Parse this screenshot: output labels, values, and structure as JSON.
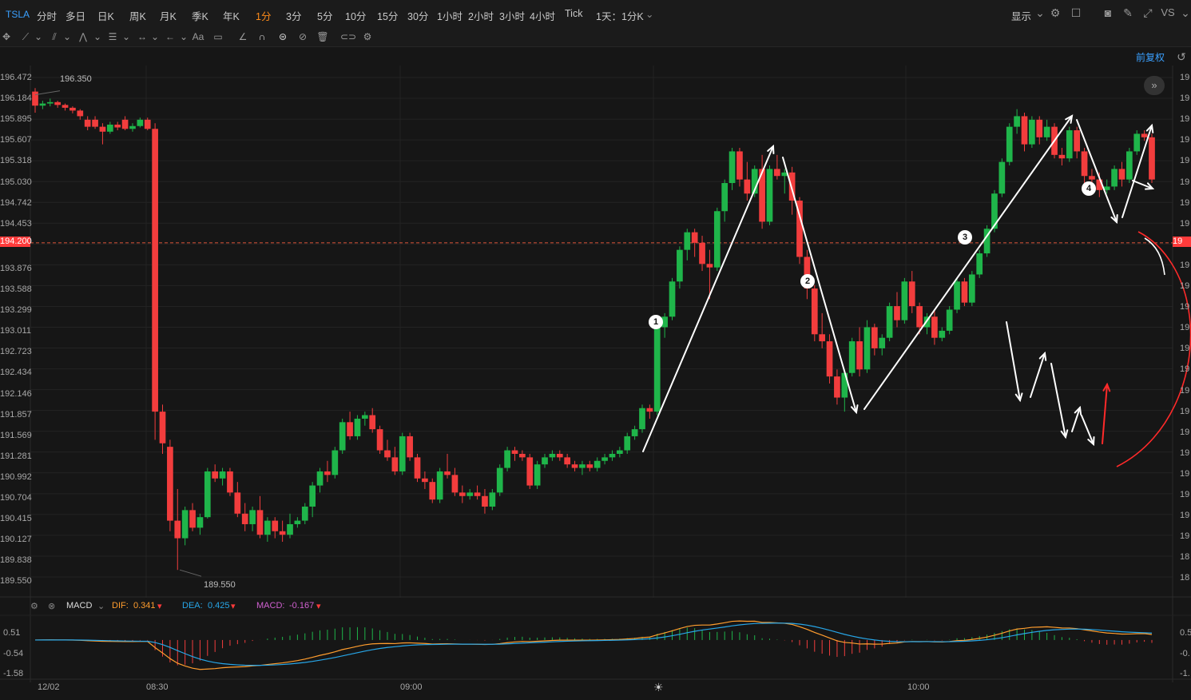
{
  "symbol": "TSLA",
  "timeframes": [
    "分时",
    "多日",
    "日K",
    "周K",
    "月K",
    "季K",
    "年K",
    "1分",
    "3分",
    "5分",
    "10分",
    "15分",
    "30分",
    "1小时",
    "2小时",
    "3小时",
    "4小时",
    "Tick"
  ],
  "active_timeframe": "1分",
  "period_select": "1天：1分K",
  "display_label": "显示",
  "adjust_label": "前复权",
  "y_axis_left": [
    "196.472",
    "196.184",
    "195.895",
    "195.607",
    "195.318",
    "195.030",
    "194.742",
    "194.453",
    "194.200",
    "193.876",
    "193.588",
    "193.299",
    "193.011",
    "192.723",
    "192.434",
    "192.146",
    "191.857",
    "191.569",
    "191.281",
    "190.992",
    "190.704",
    "190.415",
    "190.127",
    "189.838",
    "189.550"
  ],
  "current_price_label": "194.200",
  "high_label": "196.350",
  "low_label": "189.550",
  "right_axis_labels": [
    "19",
    "19",
    "19",
    "19",
    "19",
    "19",
    "19",
    "19",
    "19",
    "19",
    "19",
    "19",
    "19",
    "19",
    "19",
    "19",
    "19",
    "19",
    "19",
    "19",
    "19",
    "19",
    "18",
    "18"
  ],
  "right_price_tag": "19",
  "macd": {
    "name": "MACD",
    "dif_label": "DIF:",
    "dif_value": "0.341",
    "dea_label": "DEA:",
    "dea_value": "0.425",
    "macd_label": "MACD:",
    "macd_value": "-0.167",
    "y_left": [
      "0.51",
      "-0.54",
      "-1.58"
    ],
    "y_right": [
      "0.5",
      "-0.",
      "-1."
    ]
  },
  "x_axis": [
    "12/02",
    "08:30",
    "09:00",
    "10:00"
  ],
  "annotations": [
    "1",
    "2",
    "3",
    "4"
  ],
  "colors": {
    "up": "#1fb54a",
    "down": "#f23d3d",
    "accent": "#ff8c1a",
    "link": "#3aa0ff",
    "dif": "#ff9d2e",
    "dea": "#27a6e8",
    "macd": "#d060d0"
  },
  "chart_data": {
    "type": "candlestick",
    "interval": "1min",
    "ylim": [
      189.45,
      196.55
    ],
    "candles_ohlc": [
      [
        196.35,
        196.4,
        196.05,
        196.15
      ],
      [
        196.15,
        196.22,
        196.1,
        196.18
      ],
      [
        196.18,
        196.25,
        196.14,
        196.2
      ],
      [
        196.2,
        196.22,
        196.12,
        196.16
      ],
      [
        196.16,
        196.18,
        196.08,
        196.12
      ],
      [
        196.12,
        196.14,
        196.04,
        196.08
      ],
      [
        196.08,
        196.1,
        195.95,
        196.0
      ],
      [
        195.95,
        196.0,
        195.8,
        195.85
      ],
      [
        195.95,
        196.0,
        195.82,
        195.85
      ],
      [
        195.85,
        195.9,
        195.6,
        195.78
      ],
      [
        195.78,
        195.92,
        195.75,
        195.88
      ],
      [
        195.88,
        195.92,
        195.8,
        195.84
      ],
      [
        195.95,
        196.0,
        195.8,
        195.82
      ],
      [
        195.82,
        195.9,
        195.78,
        195.86
      ],
      [
        195.86,
        195.98,
        195.84,
        195.95
      ],
      [
        195.95,
        195.98,
        195.8,
        195.82
      ],
      [
        195.82,
        195.9,
        191.4,
        191.8
      ],
      [
        191.8,
        191.9,
        191.2,
        191.35
      ],
      [
        191.3,
        191.4,
        190.1,
        190.25
      ],
      [
        190.25,
        190.7,
        189.55,
        190.0
      ],
      [
        190.0,
        190.45,
        189.9,
        190.4
      ],
      [
        190.4,
        190.5,
        190.1,
        190.15
      ],
      [
        190.15,
        190.35,
        190.05,
        190.3
      ],
      [
        190.3,
        191.0,
        190.28,
        190.95
      ],
      [
        190.95,
        191.05,
        190.8,
        190.85
      ],
      [
        190.85,
        191.0,
        190.75,
        190.95
      ],
      [
        190.95,
        191.0,
        190.6,
        190.65
      ],
      [
        190.65,
        190.8,
        190.3,
        190.35
      ],
      [
        190.35,
        190.5,
        190.1,
        190.2
      ],
      [
        190.2,
        190.45,
        190.1,
        190.4
      ],
      [
        190.4,
        190.6,
        190.0,
        190.05
      ],
      [
        190.05,
        190.3,
        189.95,
        190.25
      ],
      [
        190.25,
        190.3,
        190.0,
        190.1
      ],
      [
        190.1,
        190.25,
        189.95,
        190.05
      ],
      [
        190.05,
        190.35,
        190.0,
        190.2
      ],
      [
        190.2,
        190.3,
        190.15,
        190.25
      ],
      [
        190.25,
        190.5,
        190.2,
        190.45
      ],
      [
        190.45,
        190.8,
        190.3,
        190.75
      ],
      [
        190.75,
        191.0,
        190.65,
        190.95
      ],
      [
        190.95,
        191.1,
        190.8,
        190.9
      ],
      [
        190.9,
        191.3,
        190.85,
        191.25
      ],
      [
        191.25,
        191.7,
        191.2,
        191.65
      ],
      [
        191.65,
        191.8,
        191.4,
        191.45
      ],
      [
        191.45,
        191.75,
        191.4,
        191.7
      ],
      [
        191.7,
        191.8,
        191.6,
        191.75
      ],
      [
        191.75,
        191.85,
        191.5,
        191.55
      ],
      [
        191.55,
        191.6,
        191.2,
        191.25
      ],
      [
        191.25,
        191.4,
        191.1,
        191.15
      ],
      [
        191.15,
        191.3,
        190.9,
        190.95
      ],
      [
        190.95,
        191.5,
        190.9,
        191.45
      ],
      [
        191.45,
        191.5,
        191.1,
        191.15
      ],
      [
        191.15,
        191.2,
        190.8,
        190.85
      ],
      [
        190.85,
        190.95,
        190.7,
        190.8
      ],
      [
        190.8,
        190.85,
        190.5,
        190.55
      ],
      [
        190.55,
        191.0,
        190.5,
        190.95
      ],
      [
        190.95,
        191.2,
        190.85,
        190.9
      ],
      [
        190.9,
        191.0,
        190.6,
        190.65
      ],
      [
        190.65,
        190.75,
        190.5,
        190.6
      ],
      [
        190.6,
        190.7,
        190.55,
        190.65
      ],
      [
        190.65,
        190.75,
        190.55,
        190.6
      ],
      [
        190.6,
        190.7,
        190.35,
        190.45
      ],
      [
        190.45,
        190.7,
        190.4,
        190.65
      ],
      [
        190.65,
        191.05,
        190.6,
        191.0
      ],
      [
        191.0,
        191.3,
        190.95,
        191.25
      ],
      [
        191.25,
        191.3,
        191.1,
        191.2
      ],
      [
        191.2,
        191.25,
        191.1,
        191.15
      ],
      [
        191.15,
        191.2,
        190.7,
        190.75
      ],
      [
        190.75,
        191.1,
        190.7,
        191.05
      ],
      [
        191.05,
        191.2,
        191.0,
        191.15
      ],
      [
        191.15,
        191.25,
        191.1,
        191.2
      ],
      [
        191.2,
        191.25,
        191.1,
        191.15
      ],
      [
        191.15,
        191.2,
        191.0,
        191.05
      ],
      [
        191.05,
        191.1,
        190.95,
        191.0
      ],
      [
        191.0,
        191.1,
        190.9,
        191.05
      ],
      [
        191.05,
        191.1,
        190.95,
        191.0
      ],
      [
        191.0,
        191.15,
        190.95,
        191.1
      ],
      [
        191.1,
        191.2,
        191.05,
        191.15
      ],
      [
        191.15,
        191.25,
        191.1,
        191.2
      ],
      [
        191.2,
        191.3,
        191.15,
        191.25
      ],
      [
        191.25,
        191.5,
        191.2,
        191.45
      ],
      [
        191.45,
        191.6,
        191.4,
        191.55
      ],
      [
        191.55,
        191.9,
        191.5,
        191.85
      ],
      [
        191.85,
        191.9,
        191.7,
        191.8
      ],
      [
        191.8,
        193.1,
        191.75,
        193.0
      ],
      [
        193.0,
        193.2,
        192.85,
        193.15
      ],
      [
        193.15,
        193.7,
        193.1,
        193.65
      ],
      [
        193.65,
        194.15,
        193.55,
        194.1
      ],
      [
        194.1,
        194.4,
        193.95,
        194.35
      ],
      [
        194.35,
        194.4,
        194.0,
        194.2
      ],
      [
        194.2,
        194.3,
        193.8,
        193.9
      ],
      [
        193.9,
        194.1,
        193.4,
        193.85
      ],
      [
        193.85,
        194.7,
        193.8,
        194.65
      ],
      [
        194.65,
        195.1,
        194.5,
        195.05
      ],
      [
        195.05,
        195.55,
        194.95,
        195.5
      ],
      [
        195.5,
        195.55,
        195.0,
        195.1
      ],
      [
        195.1,
        195.35,
        194.8,
        194.9
      ],
      [
        194.9,
        195.3,
        194.85,
        195.25
      ],
      [
        195.25,
        195.45,
        194.4,
        194.5
      ],
      [
        194.5,
        195.3,
        194.45,
        195.25
      ],
      [
        195.25,
        195.45,
        195.1,
        195.15
      ],
      [
        195.15,
        195.25,
        194.9,
        195.2
      ],
      [
        195.2,
        195.28,
        194.6,
        194.8
      ],
      [
        194.8,
        194.85,
        193.9,
        194.0
      ],
      [
        194.0,
        194.1,
        193.4,
        193.55
      ],
      [
        193.55,
        193.6,
        192.8,
        192.9
      ],
      [
        192.9,
        193.2,
        192.7,
        192.8
      ],
      [
        192.8,
        192.9,
        192.2,
        192.3
      ],
      [
        192.3,
        192.4,
        191.9,
        192.0
      ],
      [
        192.0,
        192.4,
        191.8,
        192.35
      ],
      [
        192.35,
        192.85,
        192.3,
        192.8
      ],
      [
        192.8,
        193.0,
        192.3,
        192.4
      ],
      [
        192.4,
        193.1,
        192.35,
        193.0
      ],
      [
        193.0,
        193.05,
        192.6,
        192.7
      ],
      [
        192.7,
        192.9,
        192.6,
        192.85
      ],
      [
        192.85,
        193.35,
        192.8,
        193.3
      ],
      [
        193.3,
        193.5,
        193.0,
        193.1
      ],
      [
        193.1,
        193.7,
        193.05,
        193.65
      ],
      [
        193.65,
        193.8,
        193.2,
        193.3
      ],
      [
        193.3,
        193.35,
        192.9,
        193.0
      ],
      [
        193.0,
        193.2,
        192.9,
        193.15
      ],
      [
        193.15,
        193.25,
        192.75,
        192.85
      ],
      [
        192.85,
        193.0,
        192.8,
        192.95
      ],
      [
        192.95,
        193.3,
        192.9,
        193.25
      ],
      [
        193.25,
        193.7,
        193.2,
        193.65
      ],
      [
        193.65,
        193.7,
        193.3,
        193.35
      ],
      [
        193.35,
        193.8,
        193.3,
        193.75
      ],
      [
        193.75,
        194.1,
        193.7,
        194.05
      ],
      [
        194.05,
        194.45,
        194.0,
        194.4
      ],
      [
        194.4,
        194.95,
        194.35,
        194.9
      ],
      [
        194.9,
        195.4,
        194.85,
        195.35
      ],
      [
        195.35,
        195.9,
        195.3,
        195.85
      ],
      [
        195.85,
        196.1,
        195.75,
        196.0
      ],
      [
        196.0,
        196.05,
        195.5,
        195.6
      ],
      [
        195.6,
        196.0,
        195.55,
        195.95
      ],
      [
        195.95,
        196.0,
        195.6,
        195.7
      ],
      [
        195.7,
        195.95,
        195.65,
        195.85
      ],
      [
        195.85,
        195.9,
        195.4,
        195.45
      ],
      [
        195.45,
        195.55,
        195.3,
        195.4
      ],
      [
        195.4,
        195.85,
        195.35,
        195.8
      ],
      [
        195.8,
        195.85,
        195.4,
        195.5
      ],
      [
        195.5,
        195.55,
        195.05,
        195.15
      ],
      [
        195.15,
        195.25,
        195.0,
        195.1
      ],
      [
        195.1,
        195.2,
        194.85,
        194.95
      ],
      [
        194.95,
        195.1,
        194.9,
        195.0
      ],
      [
        195.0,
        195.3,
        194.95,
        195.25
      ],
      [
        195.25,
        195.35,
        195.0,
        195.1
      ],
      [
        195.1,
        195.55,
        195.05,
        195.5
      ],
      [
        195.5,
        195.8,
        195.45,
        195.75
      ],
      [
        195.75,
        195.8,
        195.65,
        195.7
      ],
      [
        195.7,
        195.75,
        195.05,
        195.1
      ]
    ],
    "price_line": 194.2,
    "high": 196.35,
    "low": 189.55,
    "macd_series": {
      "dif": 0.341,
      "dea": 0.425,
      "macd": -0.167,
      "ylim": [
        -1.8,
        0.8
      ]
    }
  }
}
